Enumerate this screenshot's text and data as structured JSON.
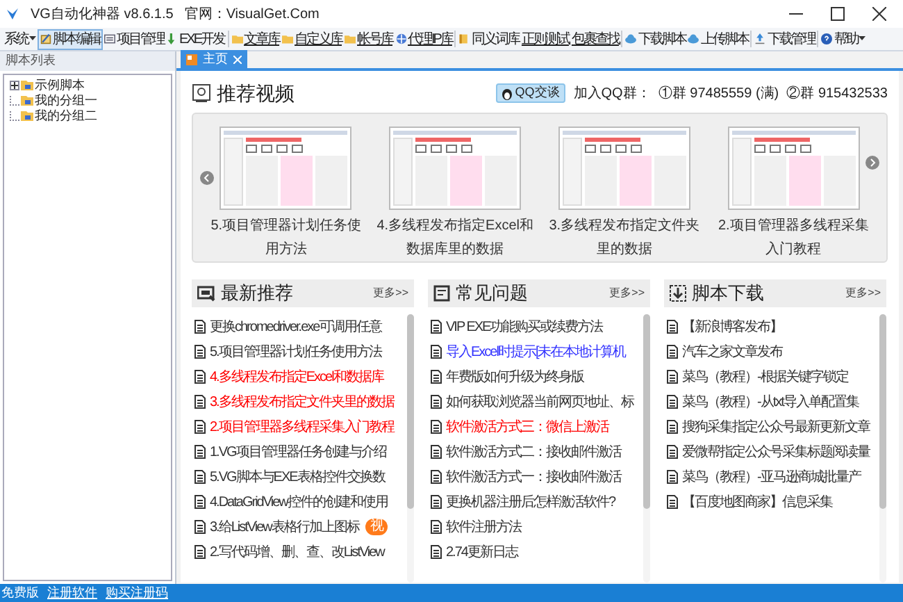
{
  "window": {
    "title": "VG自动化神器 v8.6.1.5",
    "site": "官网：VisualGet.Com"
  },
  "toolbar": [
    {
      "label": "系统",
      "kind": "menu",
      "selected": false
    },
    {
      "label": "脚本编辑",
      "kind": "button",
      "selected": true
    },
    {
      "label": "项目管理",
      "kind": "button",
      "selected": false
    },
    {
      "label": "EXE开发",
      "kind": "button",
      "selected": false
    },
    {
      "label": "文章库",
      "kind": "link",
      "selected": false
    },
    {
      "label": "自定义库",
      "kind": "link",
      "selected": false
    },
    {
      "label": "帐号库",
      "kind": "link",
      "selected": false
    },
    {
      "label": "代理IP库",
      "kind": "link",
      "selected": false
    },
    {
      "label": "同义词库",
      "kind": "button",
      "selected": false
    },
    {
      "label": "正则测试",
      "kind": "text-link",
      "selected": false
    },
    {
      "label": "包裹查找",
      "kind": "text-link",
      "selected": false
    },
    {
      "label": "下载脚本",
      "kind": "button",
      "selected": false
    },
    {
      "label": "上传脚本",
      "kind": "button",
      "selected": false
    },
    {
      "label": "下载管理",
      "kind": "button",
      "selected": false
    },
    {
      "label": "帮助",
      "kind": "menu",
      "selected": false
    }
  ],
  "sidebar": {
    "title": "脚本列表",
    "items": [
      {
        "label": "示例脚本",
        "expanded": false
      },
      {
        "label": "我的分组一"
      },
      {
        "label": "我的分组二"
      }
    ]
  },
  "tabs": [
    {
      "label": "主页",
      "selected": true
    }
  ],
  "videos": {
    "title": "推荐视频",
    "qq_button": "QQ交谈",
    "qq_text": "加入QQ群：  ①群 97485559 (满)  ②群 915432533",
    "items": [
      "5.项目管理器计划任务使用方法",
      "4.多线程发布指定Excel和数据库里的数据",
      "3.多线程发布指定文件夹里的数据",
      "2.项目管理器多线程采集入门教程"
    ]
  },
  "panels": [
    {
      "title": "最新推荐",
      "more": "更多>>",
      "items": [
        {
          "text": "更换chromedriver.exe可调用任意",
          "color": "#333333"
        },
        {
          "text": "5.项目管理器计划任务使用方法",
          "color": "#333333"
        },
        {
          "text": "4.多线程发布指定Excel和数据库",
          "color": "#ff0000"
        },
        {
          "text": "3.多线程发布指定文件夹里的数据",
          "color": "#ff0000"
        },
        {
          "text": "2.项目管理器多线程采集入门教程",
          "color": "#ff0000"
        },
        {
          "text": "1.VG项目管理器任务创建与介绍",
          "color": "#333333"
        },
        {
          "text": "5.VG脚本与EXE表格控件交换数",
          "color": "#333333"
        },
        {
          "text": "4.DataGridView控件的创建和使用",
          "color": "#333333"
        },
        {
          "text": "3.给ListView表格行加上图标",
          "color": "#333333",
          "badge": "视"
        },
        {
          "text": "2.写代码增、删、查、改ListView",
          "color": "#333333"
        }
      ]
    },
    {
      "title": "常见问题",
      "more": "更多>>",
      "items": [
        {
          "text": "VIP EXE功能购买或续费方法",
          "color": "#333333"
        },
        {
          "text": "导入Excel时提示[未在本地计算机",
          "color": "#3333ff"
        },
        {
          "text": "年费版如何升级为终身版",
          "color": "#333333"
        },
        {
          "text": "如何获取浏览器当前网页地址、标",
          "color": "#333333"
        },
        {
          "text": "软件激活方式三：微信上激活",
          "color": "#ff0000"
        },
        {
          "text": "软件激活方式二：接收邮件激活",
          "color": "#333333"
        },
        {
          "text": "软件激活方式一：接收邮件激活",
          "color": "#333333"
        },
        {
          "text": "更换机器注册后怎样激活软件?",
          "color": "#333333"
        },
        {
          "text": "软件注册方法",
          "color": "#333333"
        },
        {
          "text": "2.74更新日志",
          "color": "#333333"
        }
      ]
    },
    {
      "title": "脚本下载",
      "more": "更多>>",
      "items": [
        {
          "text": "【新浪博客发布】",
          "color": "#333333"
        },
        {
          "text": "汽车之家文章发布",
          "color": "#333333"
        },
        {
          "text": "菜鸟（教程）-根据关键字锁定",
          "color": "#333333"
        },
        {
          "text": "菜鸟（教程）-从txt导入单配置集",
          "color": "#333333"
        },
        {
          "text": "搜狗采集指定公众号最新更新文章",
          "color": "#333333"
        },
        {
          "text": "爱微帮指定公众号采集标题阅读量",
          "color": "#333333"
        },
        {
          "text": "菜鸟（教程）-亚马逊商城批量产",
          "color": "#333333"
        },
        {
          "text": "【百度地图商家】信息采集",
          "color": "#333333"
        }
      ]
    }
  ],
  "status_bar": [
    {
      "label": "免费版",
      "link": false
    },
    {
      "label": "注册软件",
      "link": true
    },
    {
      "label": "购买注册码",
      "link": true
    }
  ]
}
